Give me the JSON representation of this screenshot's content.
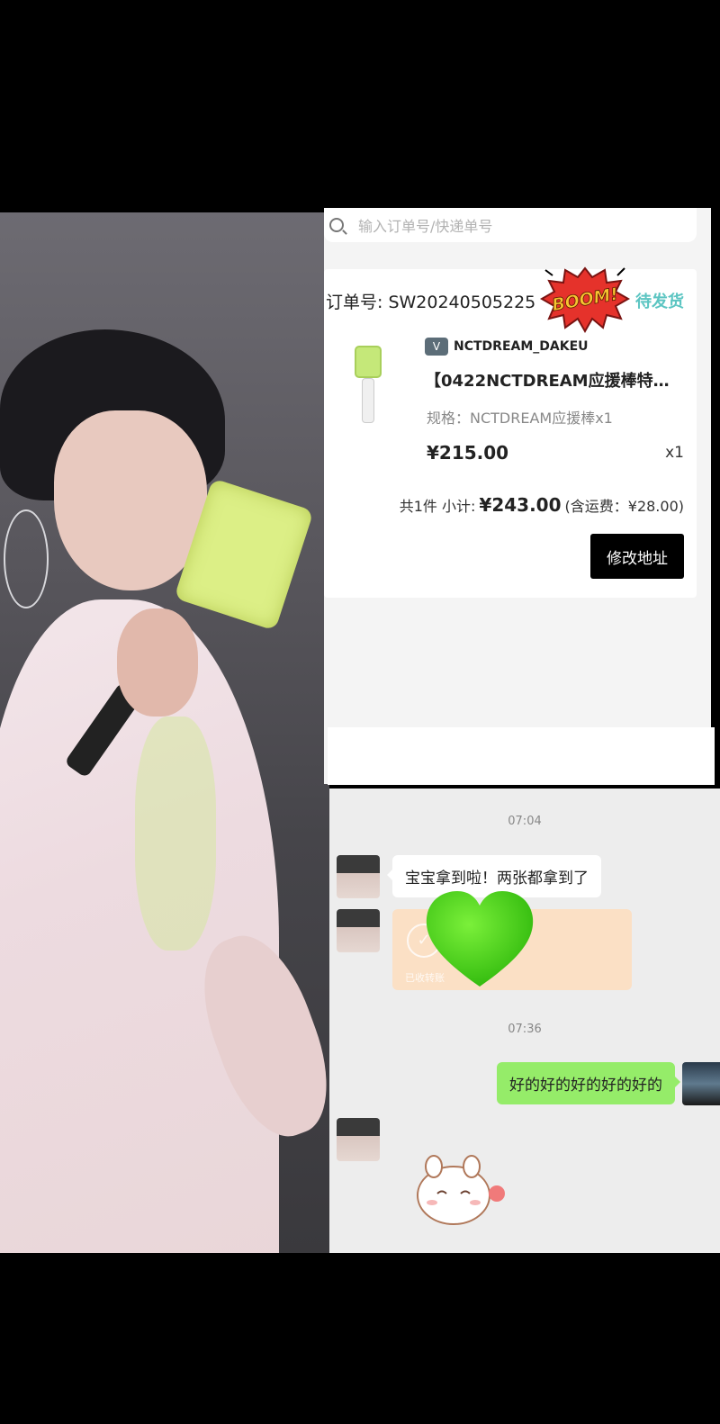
{
  "search": {
    "placeholder": "输入订单号/快递单号"
  },
  "order": {
    "number_label": "订单号: SW20240505225",
    "status": "待发货",
    "shop": {
      "icon": "shop-v-icon",
      "name": "NCTDREAM_DAKEU"
    },
    "product": {
      "title": "【0422NCTDREAM应援棒特…",
      "spec": "规格：NCTDREAM应援棒x1",
      "price": "¥215.00",
      "qty": "x1"
    },
    "subtotal": {
      "count_label": "共1件 小计:",
      "amount": "¥243.00",
      "shipping_note": "(含运费：¥28.00)"
    },
    "edit_address_label": "修改地址"
  },
  "sticker": {
    "boom_text": "BOOM!"
  },
  "chat": {
    "times": [
      "07:04",
      "07:36"
    ],
    "messages": {
      "incoming_1": "宝宝拿到啦！两张都拿到了",
      "transfer_label": "已收转账",
      "outgoing_1": "好的好的好的好的好的"
    }
  },
  "colors": {
    "status_teal": "#5cc5c2",
    "chat_bg": "#ededed",
    "outgoing_bubble": "#95ec69",
    "transfer_card": "#fbe0c5",
    "heart_green": "#3ccf16",
    "button_black": "#000000"
  }
}
